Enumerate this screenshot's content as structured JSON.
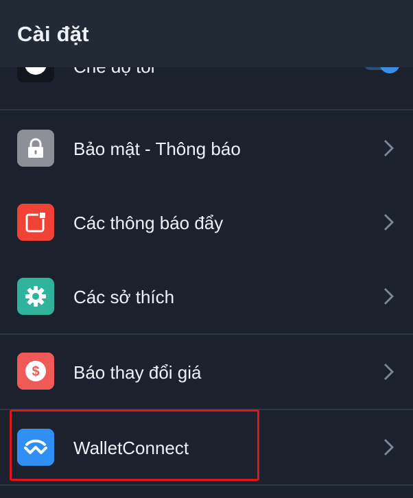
{
  "header": {
    "title": "Cài đặt"
  },
  "partial_item": {
    "label": "Chế độ tối",
    "icon": "dark-mode-icon",
    "toggle_on": true
  },
  "settings": {
    "items": [
      {
        "label": "Bảo mật - Thông báo",
        "icon": "lock-icon",
        "color": "#8e9098"
      },
      {
        "label": "Các thông báo đẩy",
        "icon": "notification-icon",
        "color": "#f04335"
      },
      {
        "label": "Các sở thích",
        "icon": "gear-icon",
        "color": "#2fb39c"
      },
      {
        "label": "Báo thay đổi giá",
        "icon": "dollar-icon",
        "color": "#f05a56"
      },
      {
        "label": "WalletConnect",
        "icon": "walletconnect-icon",
        "color": "#2f8ff3"
      }
    ]
  },
  "colors": {
    "background": "#1b212d",
    "header": "#222a36",
    "divider": "#2f3746",
    "highlight": "#e0141c",
    "toggle": "#3a8ee6"
  }
}
